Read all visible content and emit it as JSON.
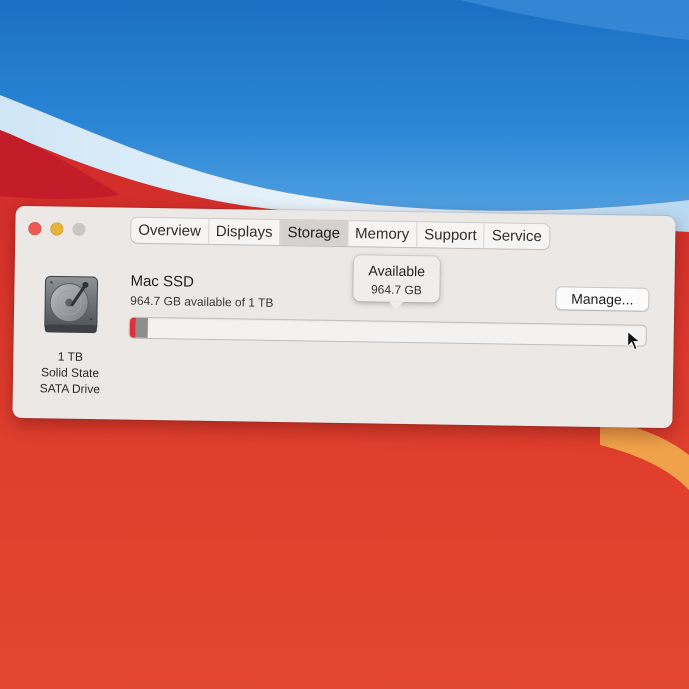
{
  "tabs": [
    {
      "label": "Overview",
      "active": false
    },
    {
      "label": "Displays",
      "active": false
    },
    {
      "label": "Storage",
      "active": true
    },
    {
      "label": "Memory",
      "active": false
    },
    {
      "label": "Support",
      "active": false
    },
    {
      "label": "Service",
      "active": false
    }
  ],
  "disk": {
    "icon": "hard-drive-icon",
    "caption": [
      "1 TB",
      "Solid State",
      "SATA Drive"
    ]
  },
  "drive": {
    "name": "Mac SSD",
    "available_text": "964.7 GB available of 1 TB"
  },
  "manage_label": "Manage...",
  "tooltip": {
    "title": "Available",
    "value": "964.7 GB"
  },
  "storage_bar": {
    "used_fraction": 0.035,
    "segments": [
      {
        "color": "#e0313a",
        "fraction": 0.012
      },
      {
        "color": "#8e8e8e",
        "fraction": 0.023
      }
    ]
  },
  "colors": {
    "close": "#ee5a51",
    "minimize": "#e5b43a",
    "zoom_inactive": "#c9c6c4"
  }
}
